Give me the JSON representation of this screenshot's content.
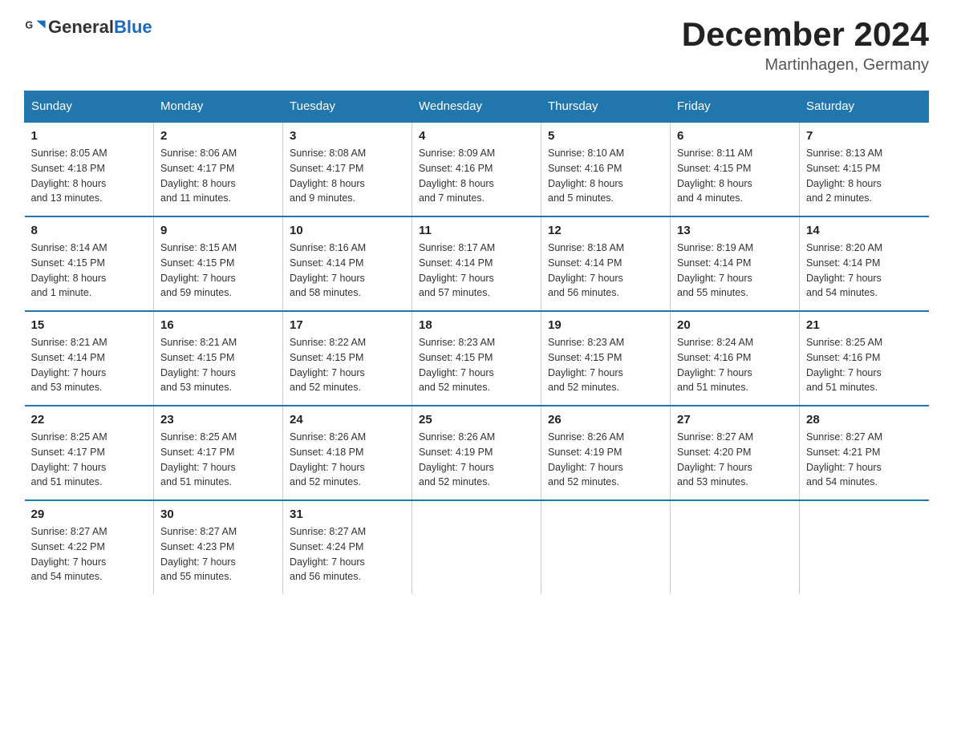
{
  "header": {
    "logo_general": "General",
    "logo_blue": "Blue",
    "title": "December 2024",
    "location": "Martinhagen, Germany"
  },
  "days_of_week": [
    "Sunday",
    "Monday",
    "Tuesday",
    "Wednesday",
    "Thursday",
    "Friday",
    "Saturday"
  ],
  "weeks": [
    [
      {
        "num": "1",
        "info": "Sunrise: 8:05 AM\nSunset: 4:18 PM\nDaylight: 8 hours\nand 13 minutes."
      },
      {
        "num": "2",
        "info": "Sunrise: 8:06 AM\nSunset: 4:17 PM\nDaylight: 8 hours\nand 11 minutes."
      },
      {
        "num": "3",
        "info": "Sunrise: 8:08 AM\nSunset: 4:17 PM\nDaylight: 8 hours\nand 9 minutes."
      },
      {
        "num": "4",
        "info": "Sunrise: 8:09 AM\nSunset: 4:16 PM\nDaylight: 8 hours\nand 7 minutes."
      },
      {
        "num": "5",
        "info": "Sunrise: 8:10 AM\nSunset: 4:16 PM\nDaylight: 8 hours\nand 5 minutes."
      },
      {
        "num": "6",
        "info": "Sunrise: 8:11 AM\nSunset: 4:15 PM\nDaylight: 8 hours\nand 4 minutes."
      },
      {
        "num": "7",
        "info": "Sunrise: 8:13 AM\nSunset: 4:15 PM\nDaylight: 8 hours\nand 2 minutes."
      }
    ],
    [
      {
        "num": "8",
        "info": "Sunrise: 8:14 AM\nSunset: 4:15 PM\nDaylight: 8 hours\nand 1 minute."
      },
      {
        "num": "9",
        "info": "Sunrise: 8:15 AM\nSunset: 4:15 PM\nDaylight: 7 hours\nand 59 minutes."
      },
      {
        "num": "10",
        "info": "Sunrise: 8:16 AM\nSunset: 4:14 PM\nDaylight: 7 hours\nand 58 minutes."
      },
      {
        "num": "11",
        "info": "Sunrise: 8:17 AM\nSunset: 4:14 PM\nDaylight: 7 hours\nand 57 minutes."
      },
      {
        "num": "12",
        "info": "Sunrise: 8:18 AM\nSunset: 4:14 PM\nDaylight: 7 hours\nand 56 minutes."
      },
      {
        "num": "13",
        "info": "Sunrise: 8:19 AM\nSunset: 4:14 PM\nDaylight: 7 hours\nand 55 minutes."
      },
      {
        "num": "14",
        "info": "Sunrise: 8:20 AM\nSunset: 4:14 PM\nDaylight: 7 hours\nand 54 minutes."
      }
    ],
    [
      {
        "num": "15",
        "info": "Sunrise: 8:21 AM\nSunset: 4:14 PM\nDaylight: 7 hours\nand 53 minutes."
      },
      {
        "num": "16",
        "info": "Sunrise: 8:21 AM\nSunset: 4:15 PM\nDaylight: 7 hours\nand 53 minutes."
      },
      {
        "num": "17",
        "info": "Sunrise: 8:22 AM\nSunset: 4:15 PM\nDaylight: 7 hours\nand 52 minutes."
      },
      {
        "num": "18",
        "info": "Sunrise: 8:23 AM\nSunset: 4:15 PM\nDaylight: 7 hours\nand 52 minutes."
      },
      {
        "num": "19",
        "info": "Sunrise: 8:23 AM\nSunset: 4:15 PM\nDaylight: 7 hours\nand 52 minutes."
      },
      {
        "num": "20",
        "info": "Sunrise: 8:24 AM\nSunset: 4:16 PM\nDaylight: 7 hours\nand 51 minutes."
      },
      {
        "num": "21",
        "info": "Sunrise: 8:25 AM\nSunset: 4:16 PM\nDaylight: 7 hours\nand 51 minutes."
      }
    ],
    [
      {
        "num": "22",
        "info": "Sunrise: 8:25 AM\nSunset: 4:17 PM\nDaylight: 7 hours\nand 51 minutes."
      },
      {
        "num": "23",
        "info": "Sunrise: 8:25 AM\nSunset: 4:17 PM\nDaylight: 7 hours\nand 51 minutes."
      },
      {
        "num": "24",
        "info": "Sunrise: 8:26 AM\nSunset: 4:18 PM\nDaylight: 7 hours\nand 52 minutes."
      },
      {
        "num": "25",
        "info": "Sunrise: 8:26 AM\nSunset: 4:19 PM\nDaylight: 7 hours\nand 52 minutes."
      },
      {
        "num": "26",
        "info": "Sunrise: 8:26 AM\nSunset: 4:19 PM\nDaylight: 7 hours\nand 52 minutes."
      },
      {
        "num": "27",
        "info": "Sunrise: 8:27 AM\nSunset: 4:20 PM\nDaylight: 7 hours\nand 53 minutes."
      },
      {
        "num": "28",
        "info": "Sunrise: 8:27 AM\nSunset: 4:21 PM\nDaylight: 7 hours\nand 54 minutes."
      }
    ],
    [
      {
        "num": "29",
        "info": "Sunrise: 8:27 AM\nSunset: 4:22 PM\nDaylight: 7 hours\nand 54 minutes."
      },
      {
        "num": "30",
        "info": "Sunrise: 8:27 AM\nSunset: 4:23 PM\nDaylight: 7 hours\nand 55 minutes."
      },
      {
        "num": "31",
        "info": "Sunrise: 8:27 AM\nSunset: 4:24 PM\nDaylight: 7 hours\nand 56 minutes."
      },
      null,
      null,
      null,
      null
    ]
  ]
}
